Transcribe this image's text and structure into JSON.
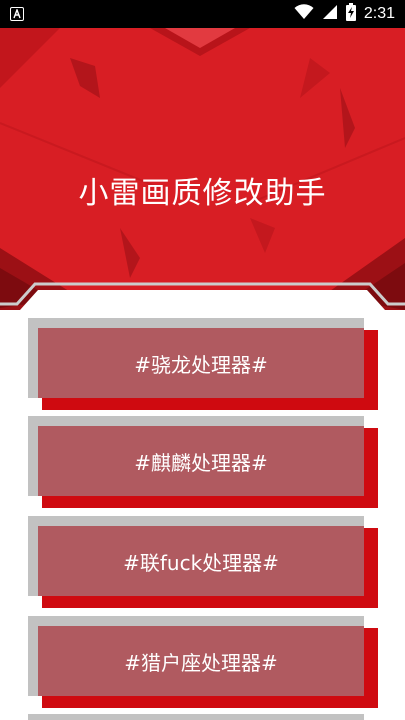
{
  "status_bar": {
    "time": "2:31",
    "icons": [
      "app-notification-icon",
      "wifi-icon",
      "signal-icon",
      "battery-charging-icon"
    ]
  },
  "header": {
    "title": "小雷画质修改助手",
    "background_color": "#d81e24"
  },
  "menu": {
    "items": [
      {
        "label": "#骁龙处理器#"
      },
      {
        "label": "#麒麟处理器#"
      },
      {
        "label": "#联fuck处理器#"
      },
      {
        "label": "#猎户座处理器#"
      }
    ],
    "face_color": "#b05a60",
    "accent_color": "#cf0a10",
    "shadow_color": "#c2c2c2"
  }
}
